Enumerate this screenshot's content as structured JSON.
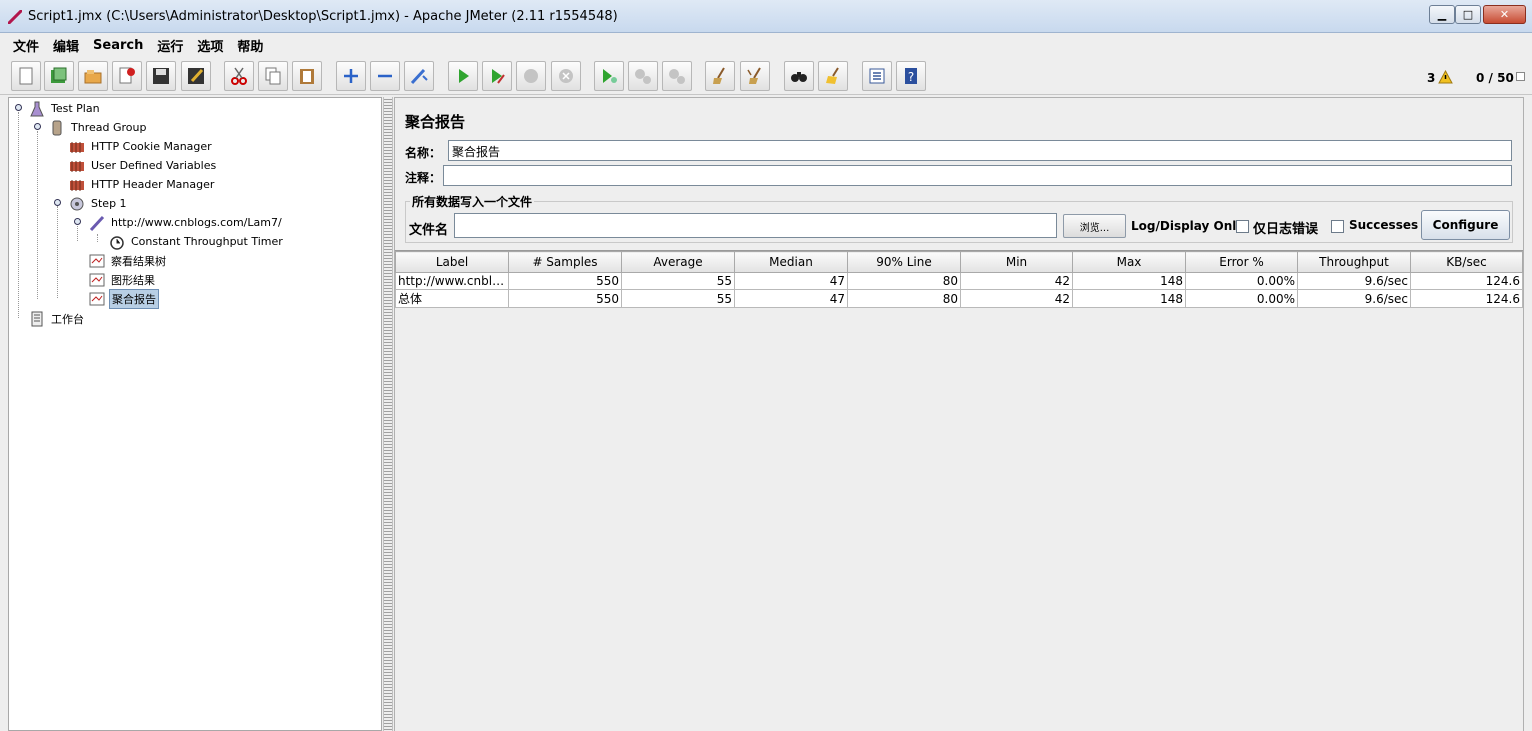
{
  "window": {
    "title": "Script1.jmx (C:\\Users\\Administrator\\Desktop\\Script1.jmx) - Apache JMeter (2.11 r1554548)"
  },
  "menu": [
    "文件",
    "编辑",
    "Search",
    "运行",
    "选项",
    "帮助"
  ],
  "toolbar": {
    "buttons": [
      "new",
      "templates",
      "open",
      "close",
      "save",
      "save-as",
      "cut",
      "copy",
      "paste",
      "expand",
      "collapse",
      "toggle",
      "start",
      "start-no-pauses",
      "stop",
      "shutdown",
      "remote-start-all",
      "remote-stop-all",
      "remote-shutdown-all",
      "clear",
      "clear-all",
      "search",
      "reset-search",
      "function-helper",
      "help"
    ],
    "warning_count": "3",
    "thread_count": "0 / 50"
  },
  "tree": [
    {
      "label": "Test Plan",
      "icon": "test-plan-icon"
    },
    {
      "label": "Thread Group",
      "icon": "thread-group-icon"
    },
    {
      "label": "HTTP Cookie Manager",
      "icon": "config-element-icon"
    },
    {
      "label": "User Defined Variables",
      "icon": "config-element-icon"
    },
    {
      "label": "HTTP Header Manager",
      "icon": "config-element-icon"
    },
    {
      "label": "Step 1",
      "icon": "controller-icon"
    },
    {
      "label": "http://www.cnblogs.com/Lam7/",
      "icon": "sampler-icon"
    },
    {
      "label": "Constant Throughput Timer",
      "icon": "timer-icon"
    },
    {
      "label": "察看结果树",
      "icon": "listener-icon"
    },
    {
      "label": "图形结果",
      "icon": "listener-icon"
    },
    {
      "label": "聚合报告",
      "icon": "listener-icon"
    },
    {
      "label": "工作台",
      "icon": "workbench-icon"
    }
  ],
  "panel": {
    "title": "聚合报告",
    "name_label": "名称：",
    "name_value": "聚合报告",
    "comment_label": "注释：",
    "comment_value": "",
    "group_title": "所有数据写入一个文件",
    "filename_label": "文件名",
    "filename_value": "",
    "browse_label": "浏览...",
    "log_display_label": "Log/Display Only:",
    "errors_only_label": "仅日志错误",
    "successes_label": "Successes",
    "configure_label": "Configure"
  },
  "table": {
    "columns": [
      "Label",
      "# Samples",
      "Average",
      "Median",
      "90% Line",
      "Min",
      "Max",
      "Error %",
      "Throughput",
      "KB/sec"
    ],
    "rows": [
      [
        "http://www.cnblog...",
        "550",
        "55",
        "47",
        "80",
        "42",
        "148",
        "0.00%",
        "9.6/sec",
        "124.6"
      ],
      [
        "总体",
        "550",
        "55",
        "47",
        "80",
        "42",
        "148",
        "0.00%",
        "9.6/sec",
        "124.6"
      ]
    ]
  }
}
